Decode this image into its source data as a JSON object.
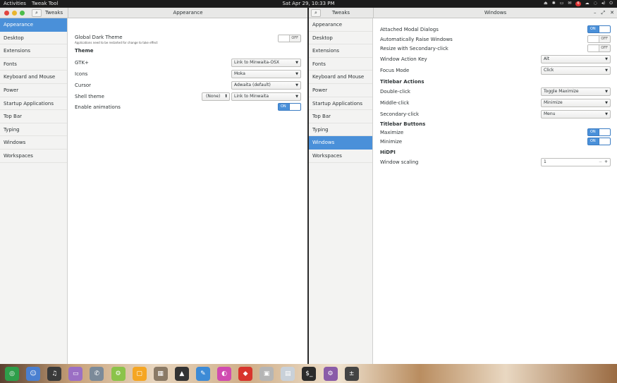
{
  "topbar": {
    "activities": "Activities",
    "app_name": "Tweak Tool",
    "clock": "Sat Apr 29, 10:33 PM",
    "badge": "6"
  },
  "left_window": {
    "sidebar_title": "Tweaks",
    "title": "Appearance",
    "sidebar": [
      "Appearance",
      "Desktop",
      "Extensions",
      "Fonts",
      "Keyboard and Mouse",
      "Power",
      "Startup Applications",
      "Top Bar",
      "Typing",
      "Windows",
      "Workspaces"
    ],
    "selected": "Appearance",
    "dark_theme_label": "Global Dark Theme",
    "dark_theme_note": "Applications need to be restarted for change to take effect",
    "dark_theme_state": "OFF",
    "theme_heading": "Theme",
    "gtk_label": "GTK+",
    "gtk_value": "Link to Minwaita-OSX",
    "icons_label": "Icons",
    "icons_value": "Moka",
    "cursor_label": "Cursor",
    "cursor_value": "Adwaita (default)",
    "shell_label": "Shell theme",
    "shell_none": "(None)",
    "shell_value": "Link to Minwaita",
    "anim_label": "Enable animations",
    "anim_state": "ON"
  },
  "right_window": {
    "sidebar_title": "Tweaks",
    "title": "Windows",
    "sidebar": [
      "Appearance",
      "Desktop",
      "Extensions",
      "Fonts",
      "Keyboard and Mouse",
      "Power",
      "Startup Applications",
      "Top Bar",
      "Typing",
      "Windows",
      "Workspaces"
    ],
    "selected": "Windows",
    "attached_label": "Attached Modal Dialogs",
    "attached_state": "ON",
    "raise_label": "Automatically Raise Windows",
    "raise_state": "OFF",
    "resize_label": "Resize with Secondary-click",
    "resize_state": "OFF",
    "action_key_label": "Window Action Key",
    "action_key_value": "Alt",
    "focus_label": "Focus Mode",
    "focus_value": "Click",
    "titlebar_actions_heading": "Titlebar Actions",
    "dbl_label": "Double-click",
    "dbl_value": "Toggle Maximize",
    "middle_label": "Middle-click",
    "middle_value": "Minimize",
    "secondary_label": "Secondary-click",
    "secondary_value": "Menu",
    "titlebar_buttons_heading": "Titlebar Buttons",
    "maximize_label": "Maximize",
    "maximize_state": "ON",
    "minimize_label": "Minimize",
    "minimize_state": "ON",
    "hidpi_heading": "HiDPI",
    "scaling_label": "Window scaling",
    "scaling_value": "1"
  },
  "dock": [
    {
      "name": "chrome-icon",
      "glyph": "◎",
      "color": "#2e9e4a"
    },
    {
      "name": "messenger-icon",
      "glyph": "☺",
      "color": "#4a7fd0"
    },
    {
      "name": "music-icon",
      "glyph": "♫",
      "color": "#3a3a3a"
    },
    {
      "name": "files-icon",
      "glyph": "▭",
      "color": "#9b6fc4"
    },
    {
      "name": "phone-icon",
      "glyph": "✆",
      "color": "#7b8a99"
    },
    {
      "name": "android-icon",
      "glyph": "⚙",
      "color": "#8bc34a"
    },
    {
      "name": "box-icon",
      "glyph": "▢",
      "color": "#f5a623"
    },
    {
      "name": "photo-icon",
      "glyph": "▦",
      "color": "#8a7a66"
    },
    {
      "name": "inkscape-icon",
      "glyph": "▲",
      "color": "#333333"
    },
    {
      "name": "editor-icon",
      "glyph": "✎",
      "color": "#3d8bd6"
    },
    {
      "name": "color-picker-icon",
      "glyph": "◐",
      "color": "#d04bb0"
    },
    {
      "name": "git-icon",
      "glyph": "◆",
      "color": "#d8342c"
    },
    {
      "name": "vm-icon",
      "glyph": "▣",
      "color": "#b5b5b5"
    },
    {
      "name": "screenshot-icon",
      "glyph": "▤",
      "color": "#c9d1d9"
    },
    {
      "name": "terminal-icon",
      "glyph": "$_",
      "color": "#2b2b2b"
    },
    {
      "name": "settings-icon",
      "glyph": "⚙",
      "color": "#8a5ca8"
    },
    {
      "name": "calculator-icon",
      "glyph": "±",
      "color": "#444444"
    }
  ]
}
